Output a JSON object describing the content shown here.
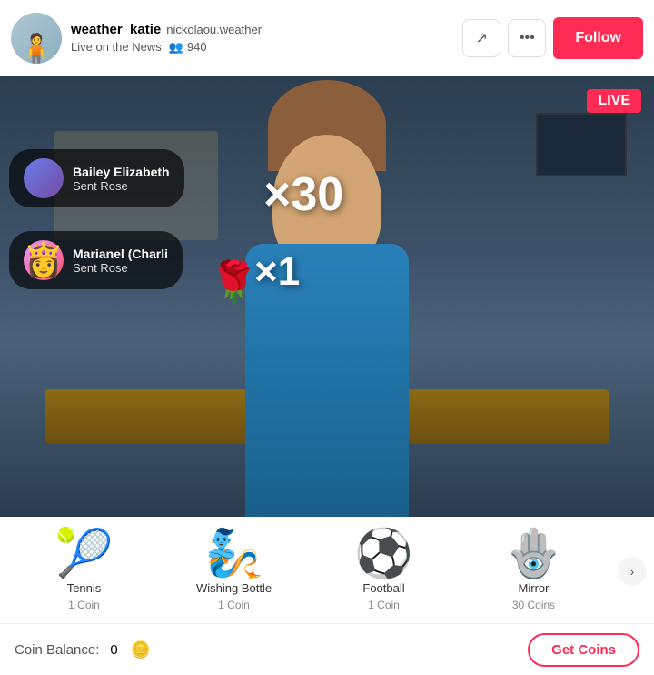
{
  "header": {
    "username": "weather_katie",
    "display_name": "nickolaou.weather",
    "live_status": "Live on the News",
    "viewers": "940",
    "follow_label": "Follow",
    "share_icon": "↗",
    "more_icon": "•••"
  },
  "video": {
    "live_badge": "LIVE",
    "notification1": {
      "name": "Bailey Elizabeth",
      "action": "Sent Rose"
    },
    "notification2": {
      "name": "Marianel (Charli",
      "action": "Sent Rose"
    },
    "multiplier1": "×30",
    "multiplier2": "×1"
  },
  "gifts": {
    "items": [
      {
        "name": "Tennis",
        "cost": "1 Coin",
        "emoji": "🎾"
      },
      {
        "name": "Wishing Bottle",
        "cost": "1 Coin",
        "emoji": "🧞"
      },
      {
        "name": "Football",
        "cost": "1 Coin",
        "emoji": "⚽"
      },
      {
        "name": "Mirror",
        "cost": "30 Coins",
        "emoji": "🪬"
      }
    ],
    "arrow_label": "›"
  },
  "coin_bar": {
    "label": "Coin Balance:",
    "amount": "0",
    "coin_emoji": "🪙",
    "get_coins_label": "Get Coins"
  }
}
